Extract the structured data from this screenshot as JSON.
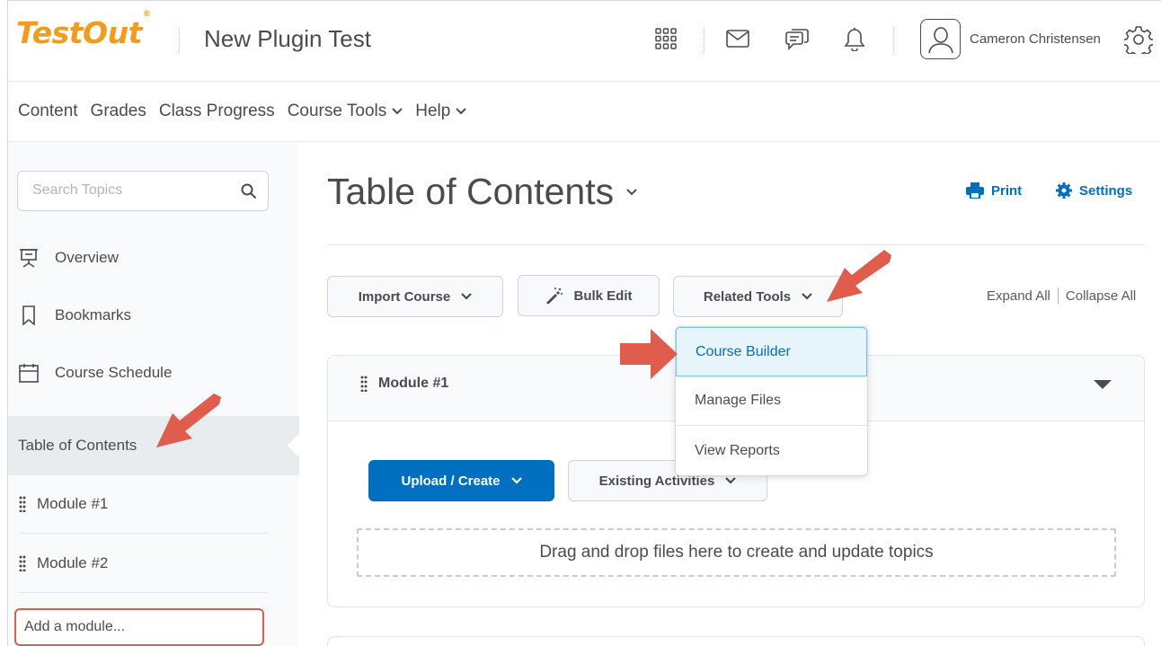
{
  "header": {
    "logo_text": "TestOut",
    "logo_mark": "®",
    "course_name": "New Plugin Test",
    "user_name": "Cameron Christensen",
    "icons": [
      "apps-grid-icon",
      "mail-icon",
      "chat-icon",
      "bell-icon",
      "user-avatar-icon",
      "gear-icon"
    ]
  },
  "nav": {
    "items": [
      {
        "label": "Content",
        "dropdown": false
      },
      {
        "label": "Grades",
        "dropdown": false
      },
      {
        "label": "Class Progress",
        "dropdown": false
      },
      {
        "label": "Course Tools",
        "dropdown": true
      },
      {
        "label": "Help",
        "dropdown": true
      }
    ]
  },
  "sidebar": {
    "search_placeholder": "Search Topics",
    "links": [
      {
        "label": "Overview",
        "icon": "presentation-icon"
      },
      {
        "label": "Bookmarks",
        "icon": "bookmark-icon"
      },
      {
        "label": "Course Schedule",
        "icon": "calendar-icon"
      }
    ],
    "toc_label": "Table of Contents",
    "modules": [
      "Module #1",
      "Module #2"
    ],
    "add_module_label": "Add a module..."
  },
  "main": {
    "title": "Table of Contents",
    "print_label": "Print",
    "settings_label": "Settings",
    "toolbar": {
      "import_course": "Import Course",
      "bulk_edit": "Bulk Edit",
      "related_tools": "Related Tools"
    },
    "expand_all": "Expand All",
    "collapse_all": "Collapse All",
    "module": {
      "title": "Module #1",
      "upload_create": "Upload / Create",
      "existing_activities": "Existing Activities",
      "drop_text": "Drag and drop files here to create and update topics"
    }
  },
  "related_tools_menu": {
    "items": [
      "Course Builder",
      "Manage Files",
      "View Reports"
    ],
    "active_index": 0
  },
  "colors": {
    "brand_orange": "#f29c1f",
    "primary_blue": "#006fbf",
    "annotation_red": "#e05d4e",
    "text": "#494c4e"
  }
}
